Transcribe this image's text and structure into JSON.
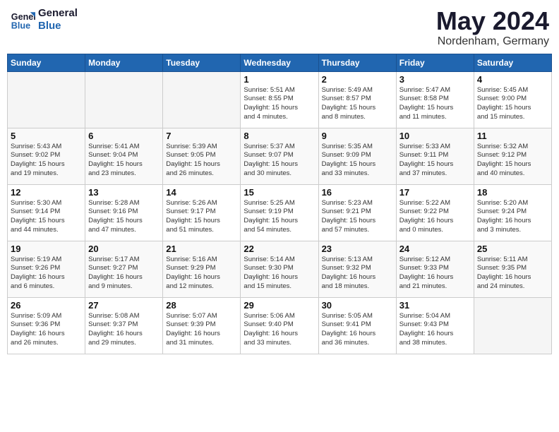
{
  "logo": {
    "line1": "General",
    "line2": "Blue"
  },
  "title": "May 2024",
  "location": "Nordenham, Germany",
  "headers": [
    "Sunday",
    "Monday",
    "Tuesday",
    "Wednesday",
    "Thursday",
    "Friday",
    "Saturday"
  ],
  "weeks": [
    [
      {
        "num": "",
        "info": ""
      },
      {
        "num": "",
        "info": ""
      },
      {
        "num": "",
        "info": ""
      },
      {
        "num": "1",
        "info": "Sunrise: 5:51 AM\nSunset: 8:55 PM\nDaylight: 15 hours\nand 4 minutes."
      },
      {
        "num": "2",
        "info": "Sunrise: 5:49 AM\nSunset: 8:57 PM\nDaylight: 15 hours\nand 8 minutes."
      },
      {
        "num": "3",
        "info": "Sunrise: 5:47 AM\nSunset: 8:58 PM\nDaylight: 15 hours\nand 11 minutes."
      },
      {
        "num": "4",
        "info": "Sunrise: 5:45 AM\nSunset: 9:00 PM\nDaylight: 15 hours\nand 15 minutes."
      }
    ],
    [
      {
        "num": "5",
        "info": "Sunrise: 5:43 AM\nSunset: 9:02 PM\nDaylight: 15 hours\nand 19 minutes."
      },
      {
        "num": "6",
        "info": "Sunrise: 5:41 AM\nSunset: 9:04 PM\nDaylight: 15 hours\nand 23 minutes."
      },
      {
        "num": "7",
        "info": "Sunrise: 5:39 AM\nSunset: 9:05 PM\nDaylight: 15 hours\nand 26 minutes."
      },
      {
        "num": "8",
        "info": "Sunrise: 5:37 AM\nSunset: 9:07 PM\nDaylight: 15 hours\nand 30 minutes."
      },
      {
        "num": "9",
        "info": "Sunrise: 5:35 AM\nSunset: 9:09 PM\nDaylight: 15 hours\nand 33 minutes."
      },
      {
        "num": "10",
        "info": "Sunrise: 5:33 AM\nSunset: 9:11 PM\nDaylight: 15 hours\nand 37 minutes."
      },
      {
        "num": "11",
        "info": "Sunrise: 5:32 AM\nSunset: 9:12 PM\nDaylight: 15 hours\nand 40 minutes."
      }
    ],
    [
      {
        "num": "12",
        "info": "Sunrise: 5:30 AM\nSunset: 9:14 PM\nDaylight: 15 hours\nand 44 minutes."
      },
      {
        "num": "13",
        "info": "Sunrise: 5:28 AM\nSunset: 9:16 PM\nDaylight: 15 hours\nand 47 minutes."
      },
      {
        "num": "14",
        "info": "Sunrise: 5:26 AM\nSunset: 9:17 PM\nDaylight: 15 hours\nand 51 minutes."
      },
      {
        "num": "15",
        "info": "Sunrise: 5:25 AM\nSunset: 9:19 PM\nDaylight: 15 hours\nand 54 minutes."
      },
      {
        "num": "16",
        "info": "Sunrise: 5:23 AM\nSunset: 9:21 PM\nDaylight: 15 hours\nand 57 minutes."
      },
      {
        "num": "17",
        "info": "Sunrise: 5:22 AM\nSunset: 9:22 PM\nDaylight: 16 hours\nand 0 minutes."
      },
      {
        "num": "18",
        "info": "Sunrise: 5:20 AM\nSunset: 9:24 PM\nDaylight: 16 hours\nand 3 minutes."
      }
    ],
    [
      {
        "num": "19",
        "info": "Sunrise: 5:19 AM\nSunset: 9:26 PM\nDaylight: 16 hours\nand 6 minutes."
      },
      {
        "num": "20",
        "info": "Sunrise: 5:17 AM\nSunset: 9:27 PM\nDaylight: 16 hours\nand 9 minutes."
      },
      {
        "num": "21",
        "info": "Sunrise: 5:16 AM\nSunset: 9:29 PM\nDaylight: 16 hours\nand 12 minutes."
      },
      {
        "num": "22",
        "info": "Sunrise: 5:14 AM\nSunset: 9:30 PM\nDaylight: 16 hours\nand 15 minutes."
      },
      {
        "num": "23",
        "info": "Sunrise: 5:13 AM\nSunset: 9:32 PM\nDaylight: 16 hours\nand 18 minutes."
      },
      {
        "num": "24",
        "info": "Sunrise: 5:12 AM\nSunset: 9:33 PM\nDaylight: 16 hours\nand 21 minutes."
      },
      {
        "num": "25",
        "info": "Sunrise: 5:11 AM\nSunset: 9:35 PM\nDaylight: 16 hours\nand 24 minutes."
      }
    ],
    [
      {
        "num": "26",
        "info": "Sunrise: 5:09 AM\nSunset: 9:36 PM\nDaylight: 16 hours\nand 26 minutes."
      },
      {
        "num": "27",
        "info": "Sunrise: 5:08 AM\nSunset: 9:37 PM\nDaylight: 16 hours\nand 29 minutes."
      },
      {
        "num": "28",
        "info": "Sunrise: 5:07 AM\nSunset: 9:39 PM\nDaylight: 16 hours\nand 31 minutes."
      },
      {
        "num": "29",
        "info": "Sunrise: 5:06 AM\nSunset: 9:40 PM\nDaylight: 16 hours\nand 33 minutes."
      },
      {
        "num": "30",
        "info": "Sunrise: 5:05 AM\nSunset: 9:41 PM\nDaylight: 16 hours\nand 36 minutes."
      },
      {
        "num": "31",
        "info": "Sunrise: 5:04 AM\nSunset: 9:43 PM\nDaylight: 16 hours\nand 38 minutes."
      },
      {
        "num": "",
        "info": ""
      }
    ]
  ]
}
